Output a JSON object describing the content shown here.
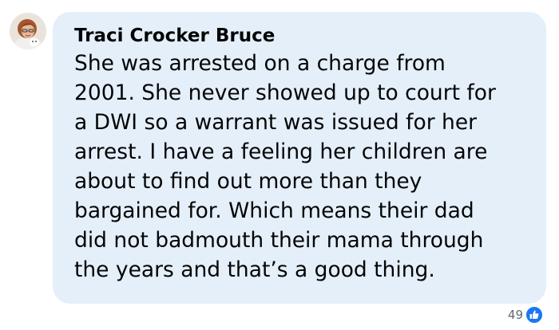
{
  "comment": {
    "author": "Traci Crocker Bruce",
    "lines": [
      "She was arrested on a charge from",
      "2001. She never showed up to court for",
      "a DWI so a warrant was issued for her",
      "arrest. I have a feeling her children are",
      "about to find out more than they",
      "bargained for. Which means their dad",
      "did not badmouth their mama through",
      "the years and that’s a good thing."
    ],
    "reaction_count": "49",
    "reaction_icon": "like-icon",
    "accent_color": "#1877f2",
    "bubble_color": "#e4effa"
  }
}
